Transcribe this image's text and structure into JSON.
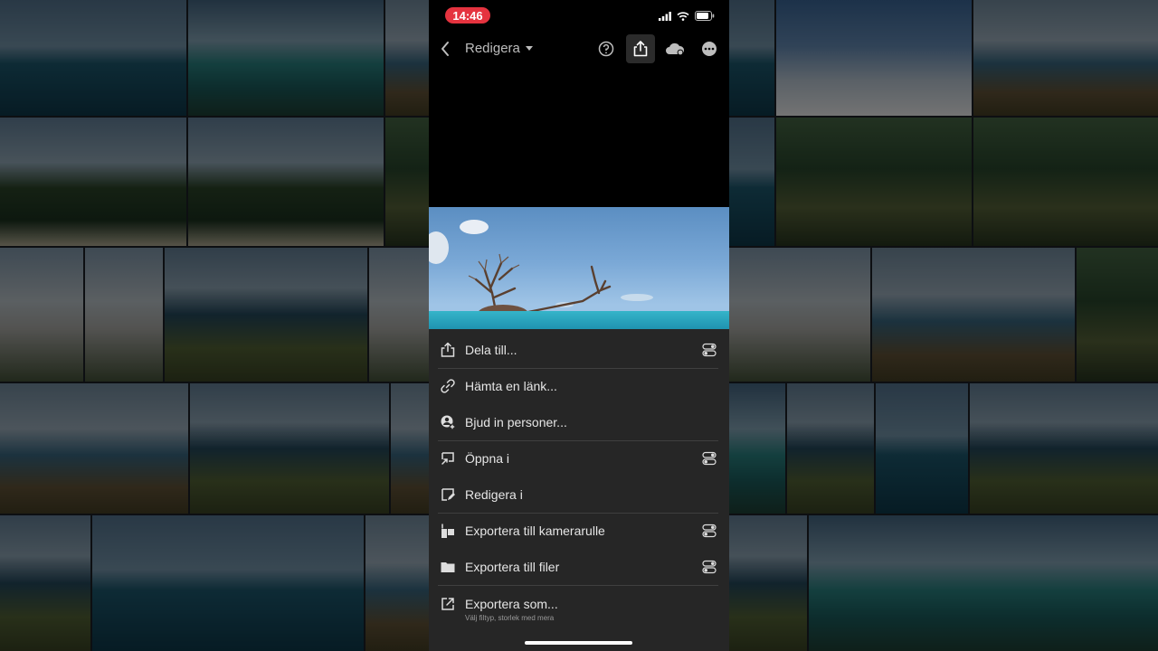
{
  "status": {
    "time": "14:46"
  },
  "header": {
    "title": "Redigera"
  },
  "menu": [
    {
      "label": "Dela till...",
      "toggle": true
    },
    {
      "label": "Hämta en länk...",
      "toggle": false
    },
    {
      "label": "Bjud in personer...",
      "toggle": false
    },
    {
      "label": "Öppna i",
      "toggle": true
    },
    {
      "label": "Redigera i",
      "toggle": false
    },
    {
      "label": "Exportera till kamerarulle",
      "toggle": true
    },
    {
      "label": "Exportera till filer",
      "toggle": true
    },
    {
      "label": "Exportera som...",
      "toggle": false,
      "sub": "Välj filtyp, storlek med mera"
    }
  ],
  "colors": {
    "accent": "#e5333f",
    "sheet": "#262626"
  }
}
